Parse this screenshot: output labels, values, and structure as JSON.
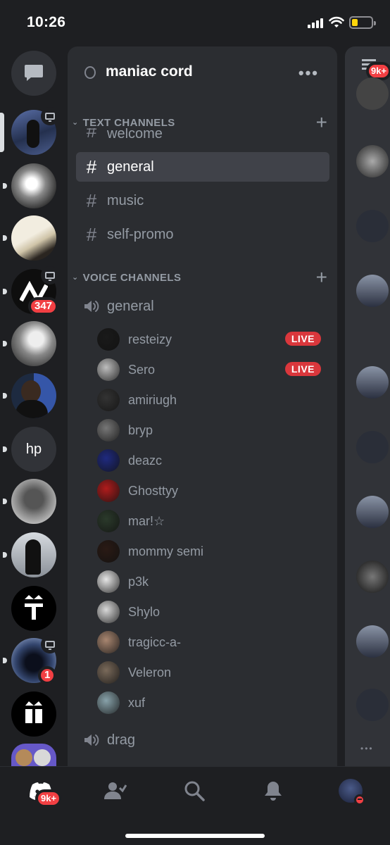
{
  "status_bar": {
    "time": "10:26"
  },
  "server_rail": {
    "servers": [
      {
        "name": "direct-messages",
        "type": "dm"
      },
      {
        "name": "server-1",
        "selected": true,
        "streaming": true,
        "color": "#3b4a7a"
      },
      {
        "name": "server-2",
        "color": "#9a9a9a"
      },
      {
        "name": "server-3",
        "color": "#e8e0c8"
      },
      {
        "name": "server-4",
        "streaming": true,
        "badge": "347",
        "color": "#0e0e0e"
      },
      {
        "name": "server-5",
        "color": "#8a8a8a"
      },
      {
        "name": "server-6",
        "color": "#4a5a78"
      },
      {
        "name": "server-hp",
        "label": "hp"
      },
      {
        "name": "server-8",
        "color": "#7a7a7a"
      },
      {
        "name": "server-9",
        "color": "#9ea4ae"
      },
      {
        "name": "server-10",
        "color": "#000000"
      },
      {
        "name": "server-11",
        "streaming": true,
        "badge": "1",
        "color": "#2a3550"
      },
      {
        "name": "server-12",
        "color": "#000000"
      },
      {
        "name": "server-13",
        "color": "#6658c8"
      }
    ]
  },
  "server": {
    "name": "maniac cord"
  },
  "text_channels": {
    "header": "TEXT CHANNELS",
    "channels": [
      {
        "name": "welcome"
      },
      {
        "name": "general",
        "selected": true
      },
      {
        "name": "music"
      },
      {
        "name": "self-promo"
      }
    ]
  },
  "voice_channels": {
    "header": "VOICE CHANNELS",
    "channels": [
      {
        "name": "general",
        "members": [
          {
            "name": "resteizy",
            "live": "LIVE",
            "color": "#1a1a1a"
          },
          {
            "name": "Sero",
            "live": "LIVE",
            "color": "#bdbdbd"
          },
          {
            "name": "amiriugh",
            "color": "#333333"
          },
          {
            "name": "bryp",
            "color": "#777777"
          },
          {
            "name": "deazc",
            "color": "#1f2a80"
          },
          {
            "name": "Ghosttyy",
            "color": "#b01c1c"
          },
          {
            "name": "mar!☆",
            "color": "#2b3a2b"
          },
          {
            "name": "mommy semi",
            "color": "#2a1a14"
          },
          {
            "name": "p3k",
            "color": "#e6e6e6"
          },
          {
            "name": "Shylo",
            "color": "#d8d8d8"
          },
          {
            "name": "tragicc-a-",
            "color": "#a88670"
          },
          {
            "name": "Veleron",
            "color": "#7a6a5a"
          },
          {
            "name": "xuf",
            "color": "#88a2aa"
          }
        ]
      },
      {
        "name": "drag"
      }
    ]
  },
  "right_peek": {
    "badge": "9k+"
  },
  "tab_bar": {
    "home_badge": "9k+",
    "tabs": [
      "home",
      "friends",
      "search",
      "notifications",
      "profile"
    ]
  }
}
